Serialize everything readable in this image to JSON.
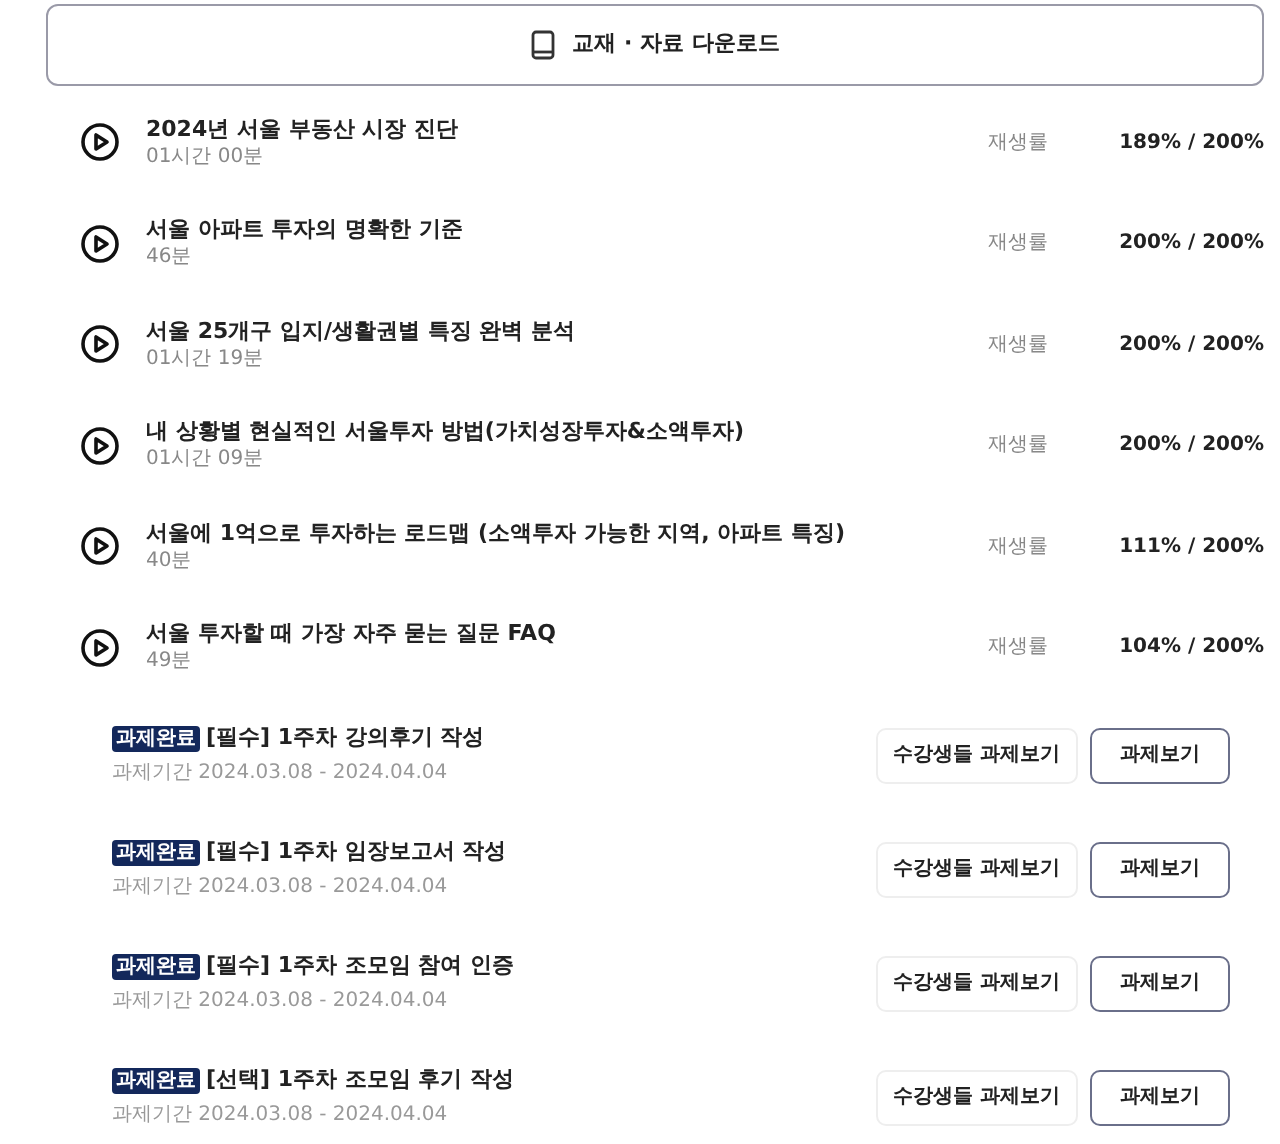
{
  "download_button": {
    "label": "교재 · 자료 다운로드"
  },
  "lectures": [
    {
      "title": "2024년 서울 부동산 시장 진단",
      "duration": "01시간 00분",
      "rate_label": "재생률",
      "rate": "189% / 200%"
    },
    {
      "title": "서울 아파트 투자의 명확한 기준",
      "duration": "46분",
      "rate_label": "재생률",
      "rate": "200% / 200%"
    },
    {
      "title": "서울 25개구 입지/생활권별 특징 완벽 분석",
      "duration": "01시간 19분",
      "rate_label": "재생률",
      "rate": "200% / 200%"
    },
    {
      "title": "내 상황별 현실적인 서울투자 방법(가치성장투자&소액투자)",
      "duration": "01시간 09분",
      "rate_label": "재생률",
      "rate": "200% / 200%"
    },
    {
      "title": "서울에 1억으로 투자하는 로드맵 (소액투자 가능한 지역, 아파트 특징)",
      "duration": "40분",
      "rate_label": "재생률",
      "rate": "111% / 200%"
    },
    {
      "title": "서울 투자할 때 가장 자주 묻는 질문 FAQ",
      "duration": "49분",
      "rate_label": "재생률",
      "rate": "104% / 200%"
    }
  ],
  "assignments": [
    {
      "badge": "과제완료",
      "title": "[필수] 1주차 강의후기 작성",
      "period": "과제기간 2024.03.08 - 2024.04.04",
      "others_button": "수강생들 과제보기",
      "view_button": "과제보기"
    },
    {
      "badge": "과제완료",
      "title": "[필수] 1주차 임장보고서 작성",
      "period": "과제기간 2024.03.08 - 2024.04.04",
      "others_button": "수강생들 과제보기",
      "view_button": "과제보기"
    },
    {
      "badge": "과제완료",
      "title": "[필수] 1주차 조모임 참여 인증",
      "period": "과제기간 2024.03.08 - 2024.04.04",
      "others_button": "수강생들 과제보기",
      "view_button": "과제보기"
    },
    {
      "badge": "과제완료",
      "title": "[선택] 1주차 조모임 후기 작성",
      "period": "과제기간 2024.03.08 - 2024.04.04",
      "others_button": "수강생들 과제보기",
      "view_button": "과제보기"
    }
  ]
}
